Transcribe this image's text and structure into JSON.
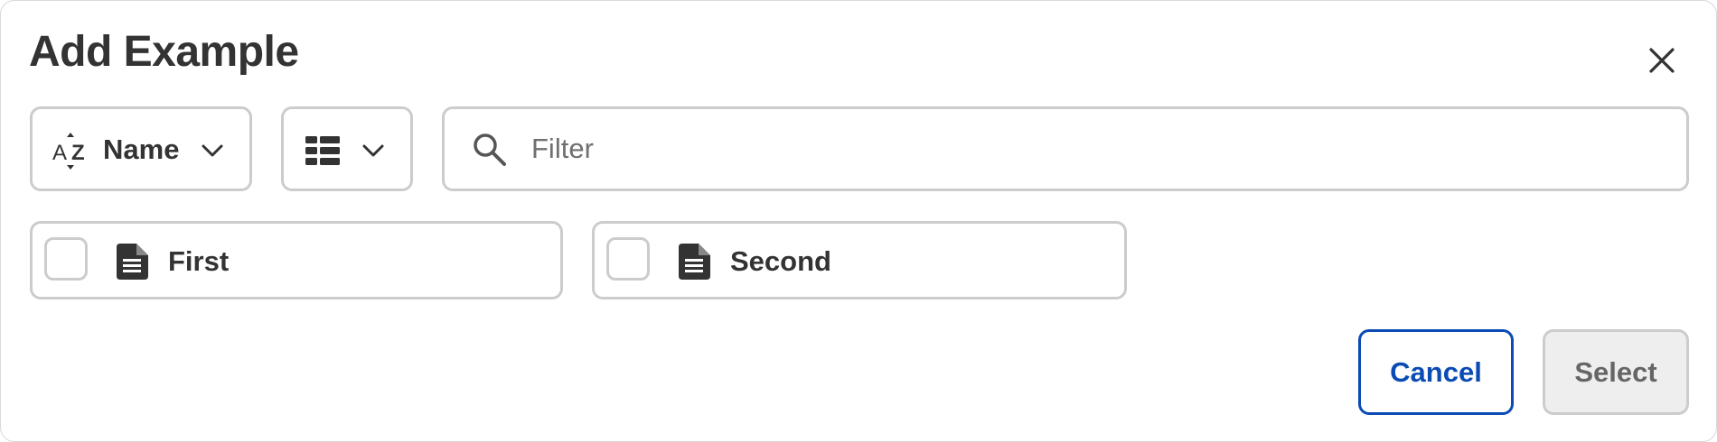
{
  "dialog": {
    "title": "Add Example",
    "close_icon": "close-icon"
  },
  "toolbar": {
    "sort": {
      "icon": "sort-az-icon",
      "label": "Name",
      "chevron_icon": "chevron-down-icon"
    },
    "view": {
      "icon": "grid-view-icon",
      "chevron_icon": "chevron-down-icon"
    },
    "filter": {
      "icon": "search-icon",
      "value": "",
      "placeholder": "Filter"
    }
  },
  "items": [
    {
      "label": "First",
      "icon": "document-icon",
      "checked": false
    },
    {
      "label": "Second",
      "icon": "document-icon",
      "checked": false
    }
  ],
  "actions": {
    "cancel_label": "Cancel",
    "select_label": "Select",
    "cancel_color": "#0a4bb5",
    "select_disabled": true
  }
}
